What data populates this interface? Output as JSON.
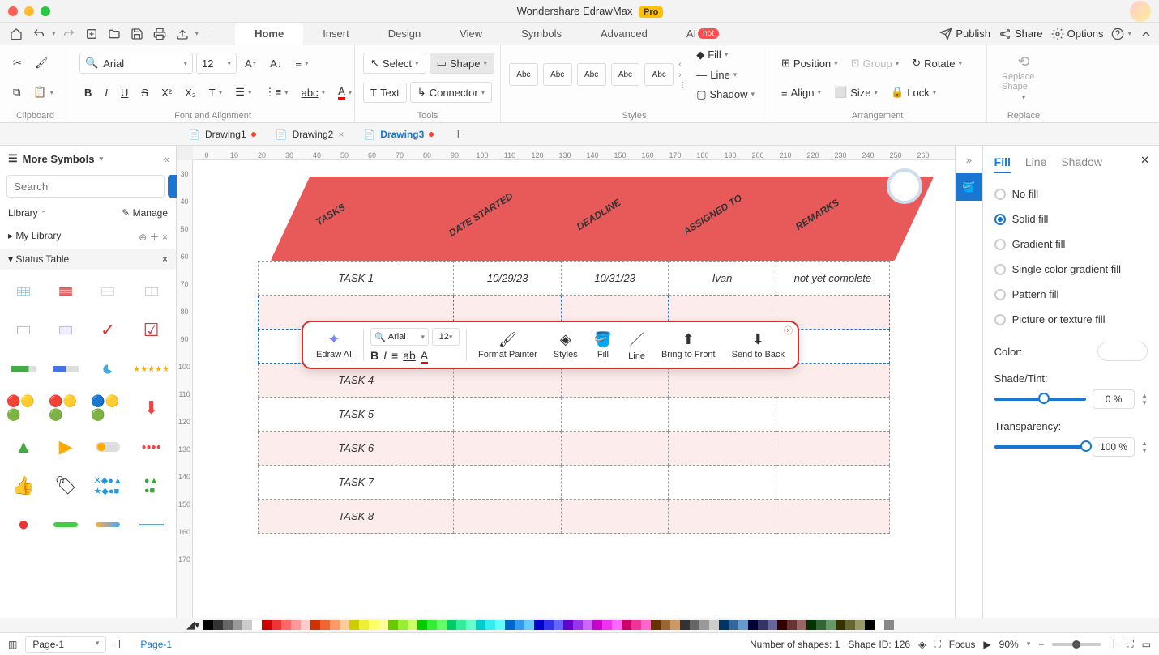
{
  "app": {
    "title": "Wondershare EdrawMax",
    "pro": "Pro"
  },
  "top_icons": [
    "home",
    "undo",
    "redo",
    "new",
    "open",
    "save",
    "print",
    "export"
  ],
  "menu": {
    "tabs": [
      "Home",
      "Insert",
      "Design",
      "View",
      "Symbols",
      "Advanced",
      "AI"
    ],
    "active": "Home",
    "hot": "hot"
  },
  "top_right": {
    "publish": "Publish",
    "share": "Share",
    "options": "Options"
  },
  "ribbon": {
    "clipboard": "Clipboard",
    "font_alignment": "Font and Alignment",
    "tools": "Tools",
    "styles": "Styles",
    "arrangement": "Arrangement",
    "replace": "Replace",
    "font_name": "Arial",
    "font_size": "12",
    "select": "Select",
    "shape": "Shape",
    "text": "Text",
    "connector": "Connector",
    "style_preset": "Abc",
    "fill": "Fill",
    "line": "Line",
    "shadow": "Shadow",
    "position": "Position",
    "align": "Align",
    "group": "Group",
    "size": "Size",
    "rotate": "Rotate",
    "lock": "Lock",
    "replace_shape": "Replace Shape"
  },
  "doc_tabs": [
    {
      "name": "Drawing1",
      "modified": true,
      "active": false
    },
    {
      "name": "Drawing2",
      "modified": false,
      "active": false,
      "closable": true
    },
    {
      "name": "Drawing3",
      "modified": true,
      "active": true
    }
  ],
  "sidebar": {
    "more_symbols": "More Symbols",
    "search_placeholder": "Search",
    "search_btn": "Search",
    "library": "Library",
    "manage": "Manage",
    "my_library": "My Library",
    "status_table": "Status Table"
  },
  "ruler_h": [
    "0",
    "10",
    "20",
    "30",
    "40",
    "50",
    "60",
    "70",
    "80",
    "90",
    "100",
    "110",
    "120",
    "130",
    "140",
    "150",
    "160",
    "170",
    "180",
    "190",
    "200",
    "210",
    "220",
    "230",
    "240",
    "250",
    "260"
  ],
  "ruler_v": [
    "30",
    "40",
    "50",
    "60",
    "70",
    "80",
    "90",
    "100",
    "110",
    "120",
    "130",
    "140",
    "150",
    "160",
    "170"
  ],
  "table": {
    "headers": [
      "TASKS",
      "DATE STARTED",
      "DEADLINE",
      "ASSIGNED TO",
      "REMARKS"
    ],
    "rows": [
      [
        "TASK 1",
        "10/29/23",
        "10/31/23",
        "Ivan",
        "not yet complete"
      ],
      [
        "",
        "",
        "",
        "",
        ""
      ],
      [
        "",
        "",
        "",
        "",
        ""
      ],
      [
        "TASK 4",
        "",
        "",
        "",
        ""
      ],
      [
        "TASK 5",
        "",
        "",
        "",
        ""
      ],
      [
        "TASK 6",
        "",
        "",
        "",
        ""
      ],
      [
        "TASK 7",
        "",
        "",
        "",
        ""
      ],
      [
        "TASK 8",
        "",
        "",
        "",
        ""
      ]
    ]
  },
  "float": {
    "edraw_ai": "Edraw AI",
    "font": "Arial",
    "size": "12",
    "format_painter": "Format Painter",
    "styles": "Styles",
    "fill": "Fill",
    "line": "Line",
    "bring_front": "Bring to Front",
    "send_back": "Send to Back"
  },
  "right": {
    "tabs": [
      "Fill",
      "Line",
      "Shadow"
    ],
    "active": "Fill",
    "options": [
      "No fill",
      "Solid fill",
      "Gradient fill",
      "Single color gradient fill",
      "Pattern fill",
      "Picture or texture fill"
    ],
    "selected": "Solid fill",
    "color_label": "Color:",
    "shade_label": "Shade/Tint:",
    "shade_val": "0 %",
    "transparency_label": "Transparency:",
    "transparency_val": "100 %"
  },
  "status": {
    "page_sel": "Page-1",
    "page_tab": "Page-1",
    "shape_count": "Number of shapes: 1",
    "shape_id": "Shape ID: 126",
    "focus": "Focus",
    "zoom": "90%"
  },
  "palette_colors": [
    "#000",
    "#333",
    "#666",
    "#999",
    "#ccc",
    "#fff",
    "#c00",
    "#e33",
    "#f66",
    "#f99",
    "#fcc",
    "#c30",
    "#e63",
    "#f96",
    "#fc9",
    "#cc0",
    "#ee3",
    "#ff6",
    "#ff9",
    "#6c0",
    "#9e3",
    "#cf6",
    "#0c0",
    "#3e3",
    "#6f6",
    "#0c6",
    "#3e9",
    "#6fc",
    "#0cc",
    "#3ee",
    "#6ff",
    "#06c",
    "#39e",
    "#6cf",
    "#00c",
    "#33e",
    "#66f",
    "#60c",
    "#93e",
    "#c6f",
    "#c0c",
    "#e3e",
    "#f6f",
    "#c06",
    "#e39",
    "#f6c",
    "#630",
    "#963",
    "#c96",
    "#333",
    "#666",
    "#999",
    "#ccc",
    "#036",
    "#369",
    "#69c",
    "#003",
    "#336",
    "#669",
    "#300",
    "#633",
    "#966",
    "#030",
    "#363",
    "#696",
    "#330",
    "#663",
    "#996",
    "#000",
    "#fff",
    "#888"
  ]
}
